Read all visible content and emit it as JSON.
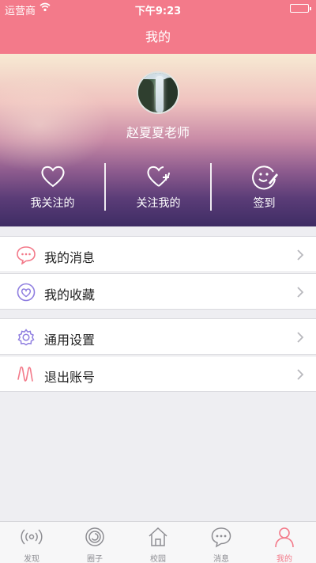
{
  "status_bar": {
    "carrier": "运营商",
    "time": "下午9:23"
  },
  "nav": {
    "title": "我的"
  },
  "profile": {
    "name": "赵夏夏老师",
    "actions": [
      {
        "label": "我关注的",
        "icon": "heart-icon"
      },
      {
        "label": "关注我的",
        "icon": "heart-plus-icon"
      },
      {
        "label": "签到",
        "icon": "smile-sign-icon"
      }
    ]
  },
  "menu": {
    "group1": [
      {
        "label": "我的消息",
        "icon": "message-bubble-icon"
      },
      {
        "label": "我的收藏",
        "icon": "heart-circle-icon"
      }
    ],
    "group2": [
      {
        "label": "通用设置",
        "icon": "gear-icon"
      },
      {
        "label": "退出账号",
        "icon": "logout-squiggle-icon"
      }
    ]
  },
  "tabs": [
    {
      "label": "发现",
      "icon": "radio-signal-icon"
    },
    {
      "label": "圈子",
      "icon": "circle-spiral-icon"
    },
    {
      "label": "校园",
      "icon": "house-icon"
    },
    {
      "label": "消息",
      "icon": "chat-bubble-icon"
    },
    {
      "label": "我的",
      "icon": "person-icon",
      "active": true
    }
  ],
  "colors": {
    "accent": "#f37a8a",
    "tab_inactive": "#8e8e93"
  }
}
